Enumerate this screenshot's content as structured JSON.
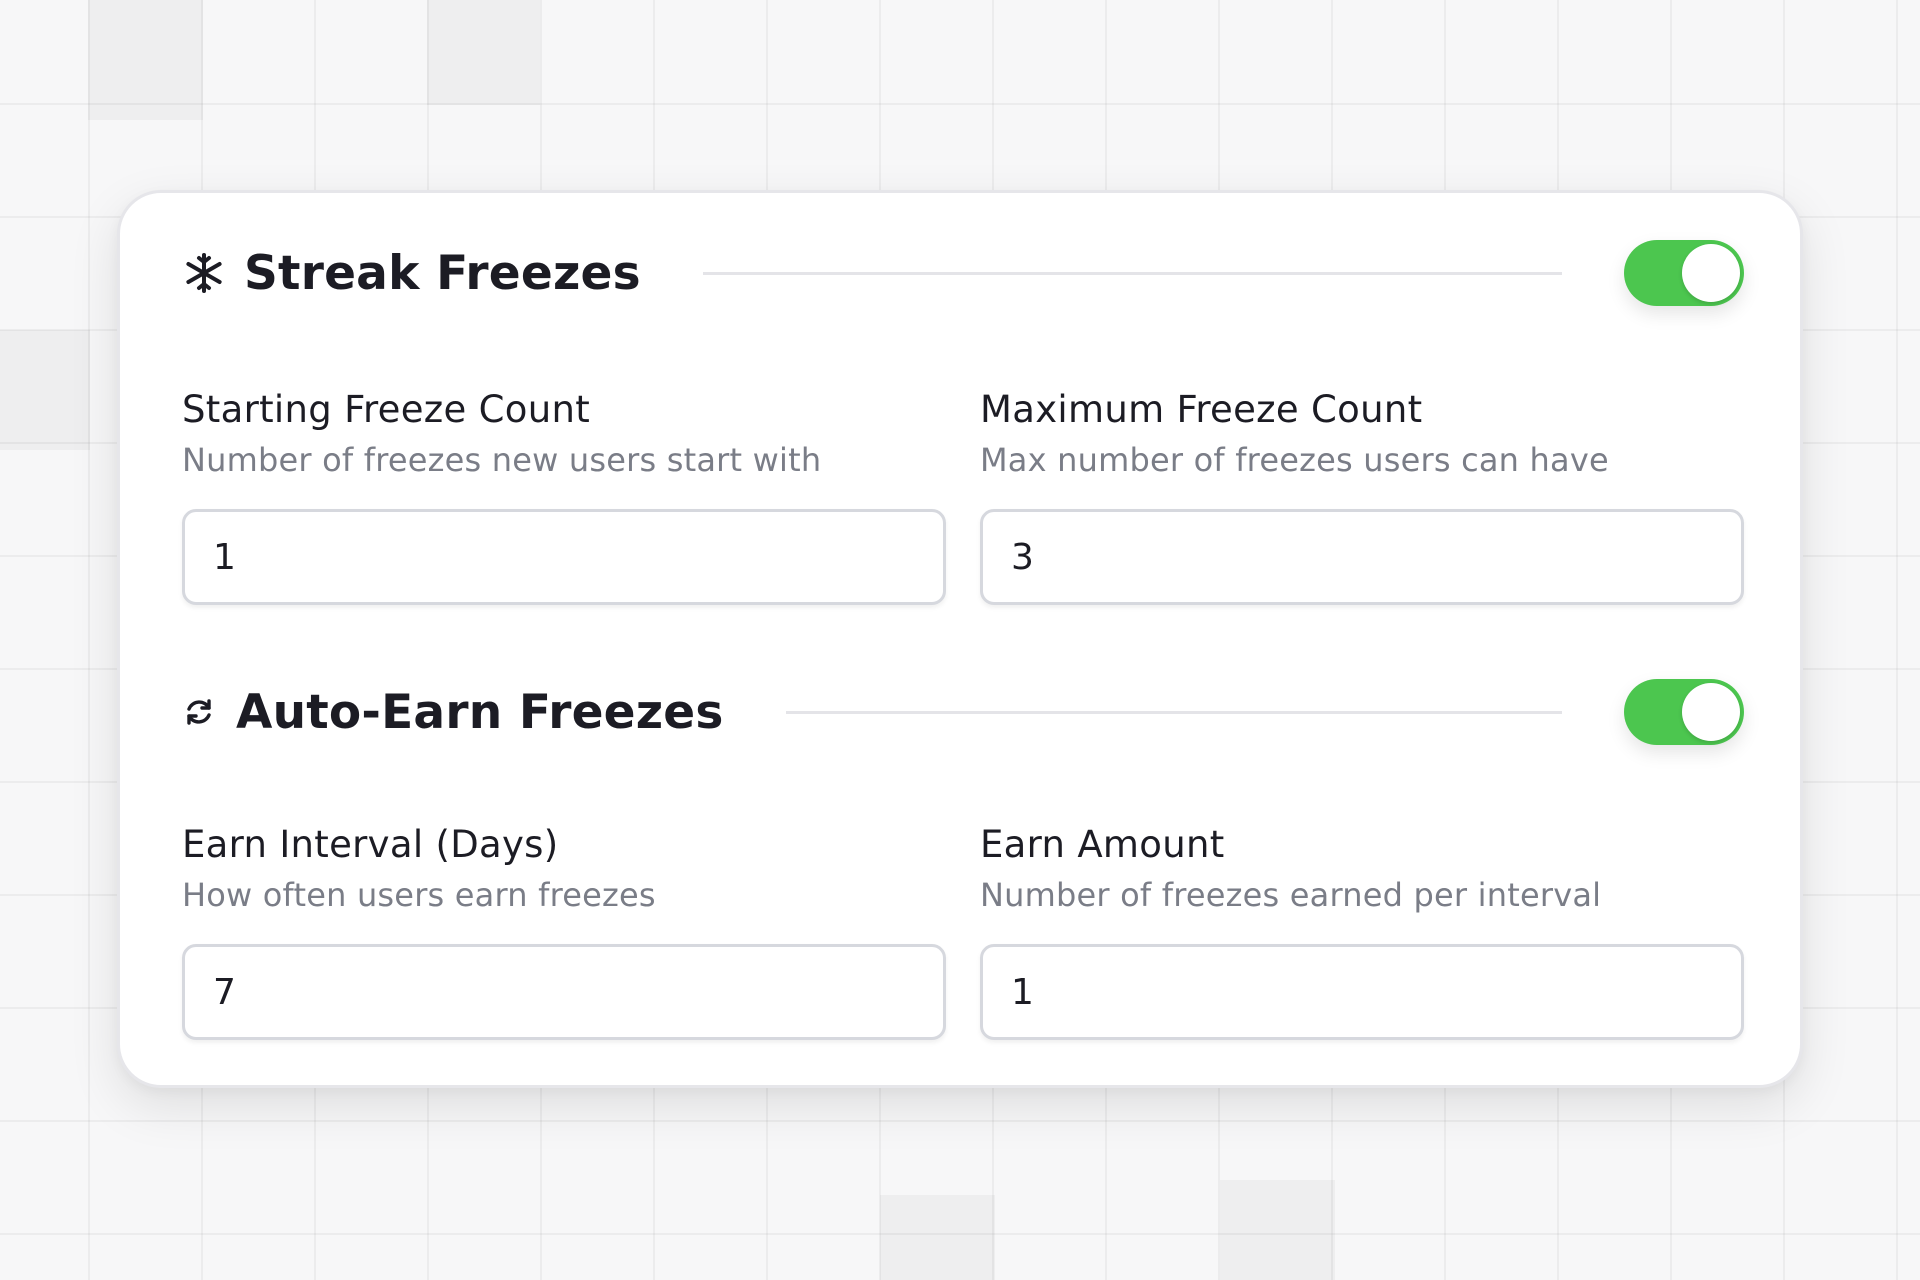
{
  "colors": {
    "toggle_on": "#4cc64f",
    "card_bg": "#ffffff",
    "help_text": "#7a7d87",
    "input_border": "#d6d8de"
  },
  "streak_freezes": {
    "title": "Streak Freezes",
    "icon": "snowflake-icon",
    "enabled": true,
    "starting_count": {
      "label": "Starting Freeze Count",
      "help": "Number of freezes new users start with",
      "value": "1"
    },
    "maximum_count": {
      "label": "Maximum Freeze Count",
      "help": "Max number of freezes users can have",
      "value": "3"
    }
  },
  "auto_earn": {
    "title": "Auto-Earn Freezes",
    "icon": "refresh-icon",
    "enabled": true,
    "earn_interval": {
      "label": "Earn Interval (Days)",
      "help": "How often users earn freezes",
      "value": "7"
    },
    "earn_amount": {
      "label": "Earn Amount",
      "help": "Number of freezes earned per interval",
      "value": "1"
    }
  }
}
